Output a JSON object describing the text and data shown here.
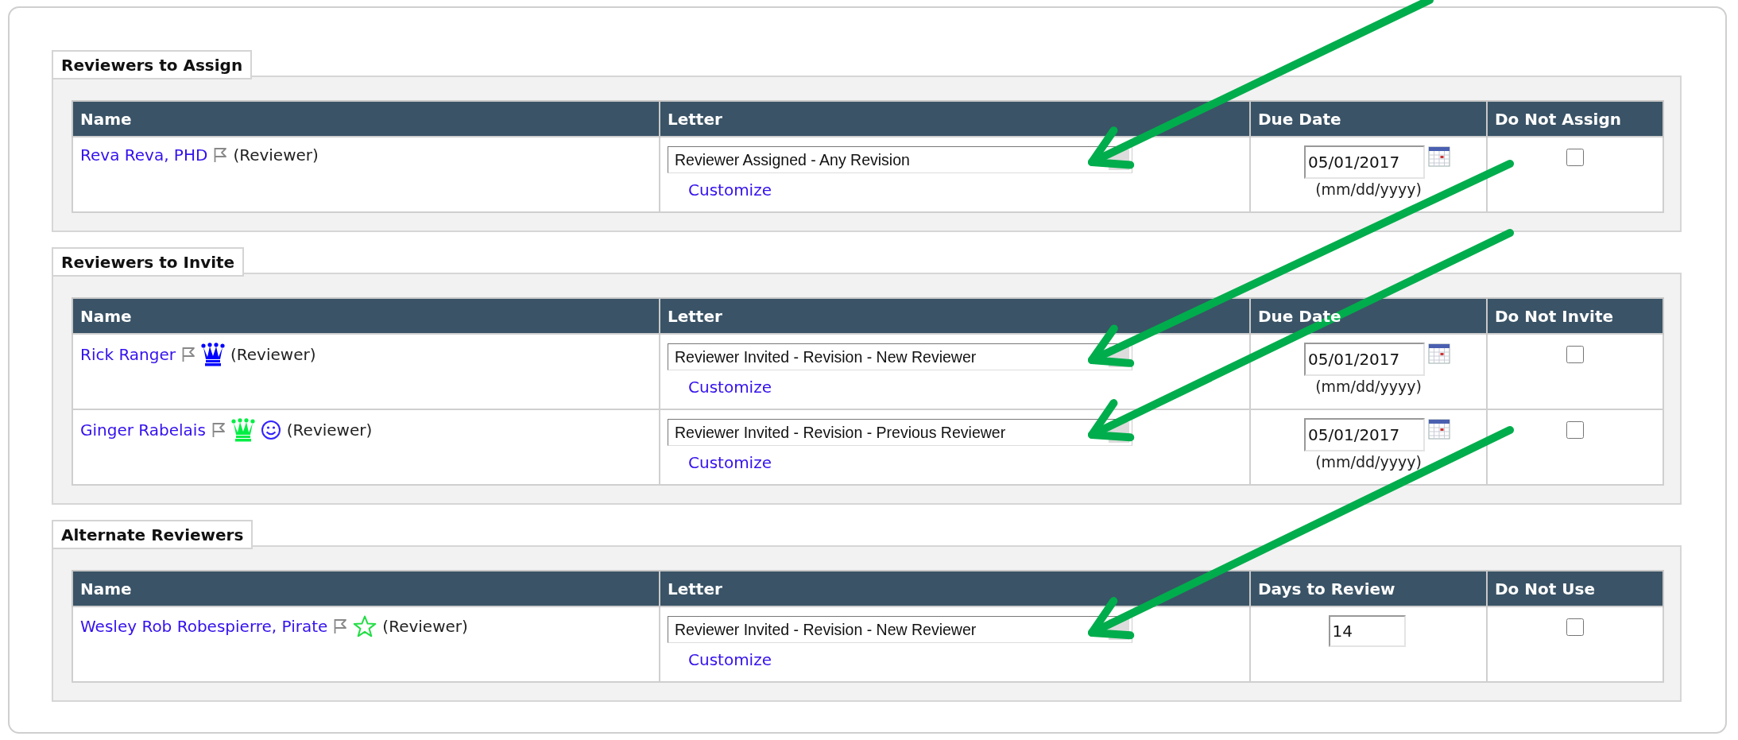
{
  "sections": [
    {
      "title": "Reviewers to Assign",
      "columns": [
        "Name",
        "Letter",
        "Due Date",
        "Do Not Assign"
      ],
      "rows": [
        {
          "name": "Reva Reva, PHD",
          "icons": [
            {
              "kind": "flag"
            }
          ],
          "role": "(Reviewer)",
          "letter": "Reviewer Assigned - Any Revision",
          "customize": "Customize",
          "due": {
            "kind": "date",
            "value": "05/01/2017",
            "hint": "(mm/dd/yyyy)"
          },
          "checked": false
        }
      ]
    },
    {
      "title": "Reviewers to Invite",
      "columns": [
        "Name",
        "Letter",
        "Due Date",
        "Do Not Invite"
      ],
      "rows": [
        {
          "name": "Rick Ranger",
          "icons": [
            {
              "kind": "flag"
            },
            {
              "kind": "crown",
              "color": "#0000ff"
            }
          ],
          "role": "(Reviewer)",
          "letter": "Reviewer Invited - Revision - New Reviewer",
          "customize": "Customize",
          "due": {
            "kind": "date",
            "value": "05/01/2017",
            "hint": "(mm/dd/yyyy)"
          },
          "checked": false
        },
        {
          "name": "Ginger Rabelais",
          "icons": [
            {
              "kind": "flag"
            },
            {
              "kind": "crown",
              "color": "#00ee44"
            },
            {
              "kind": "smiley",
              "color": "#3322ff"
            }
          ],
          "role": "(Reviewer)",
          "letter": "Reviewer Invited - Revision - Previous Reviewer",
          "customize": "Customize",
          "due": {
            "kind": "date",
            "value": "05/01/2017",
            "hint": "(mm/dd/yyyy)"
          },
          "checked": false
        }
      ]
    },
    {
      "title": "Alternate Reviewers",
      "columns": [
        "Name",
        "Letter",
        "Days to Review",
        "Do Not Use"
      ],
      "rows": [
        {
          "name": "Wesley Rob Robespierre, Pirate",
          "icons": [
            {
              "kind": "flag"
            },
            {
              "kind": "star",
              "color": "#22dd44"
            }
          ],
          "role": "(Reviewer)",
          "letter": "Reviewer Invited - Revision - New Reviewer",
          "customize": "Customize",
          "due": {
            "kind": "days",
            "value": "14"
          },
          "checked": false
        }
      ]
    }
  ]
}
